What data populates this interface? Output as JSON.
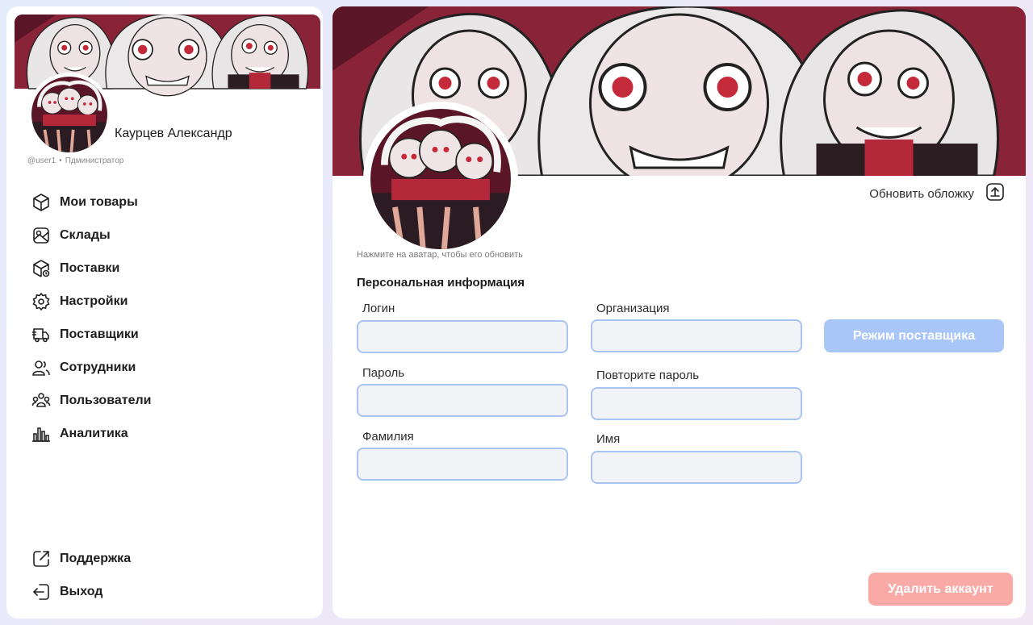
{
  "profile": {
    "name": "Каурцев Александр",
    "login": "@user1",
    "role": "Пдминистратор"
  },
  "nav": {
    "items": [
      {
        "label": "Мои товары",
        "icon": "box-icon"
      },
      {
        "label": "Склады",
        "icon": "warehouse-map-icon"
      },
      {
        "label": "Поставки",
        "icon": "delivery-box-icon"
      },
      {
        "label": "Настройки",
        "icon": "gear-icon"
      },
      {
        "label": "Поставщики",
        "icon": "truck-icon"
      },
      {
        "label": "Сотрудники",
        "icon": "users-icon"
      },
      {
        "label": "Пользователи",
        "icon": "user-group-icon"
      },
      {
        "label": "Аналитика",
        "icon": "bar-chart-icon"
      }
    ],
    "bottom": [
      {
        "label": "Поддержка",
        "icon": "external-link-icon"
      },
      {
        "label": "Выход",
        "icon": "logout-icon"
      }
    ]
  },
  "main": {
    "cover_update_label": "Обновить обложку",
    "avatar_hint": "Нажмите на аватар, чтобы его обновить",
    "section_title": "Персональная информация",
    "fields": {
      "login": {
        "label": "Логин",
        "value": ""
      },
      "organization": {
        "label": "Организация",
        "value": ""
      },
      "password": {
        "label": "Пароль",
        "value": ""
      },
      "password_repeat": {
        "label": "Повторите пароль",
        "value": ""
      },
      "last_name": {
        "label": "Фамилия",
        "value": ""
      },
      "first_name": {
        "label": "Имя",
        "value": ""
      }
    },
    "supplier_mode_label": "Режим поставщика",
    "delete_account_label": "Удалить аккаунт"
  },
  "colors": {
    "accent_blue": "#a8c6f8",
    "field_border": "#a9c4f2",
    "danger": "#f9a9a6",
    "banner_red": "#8a2236"
  }
}
